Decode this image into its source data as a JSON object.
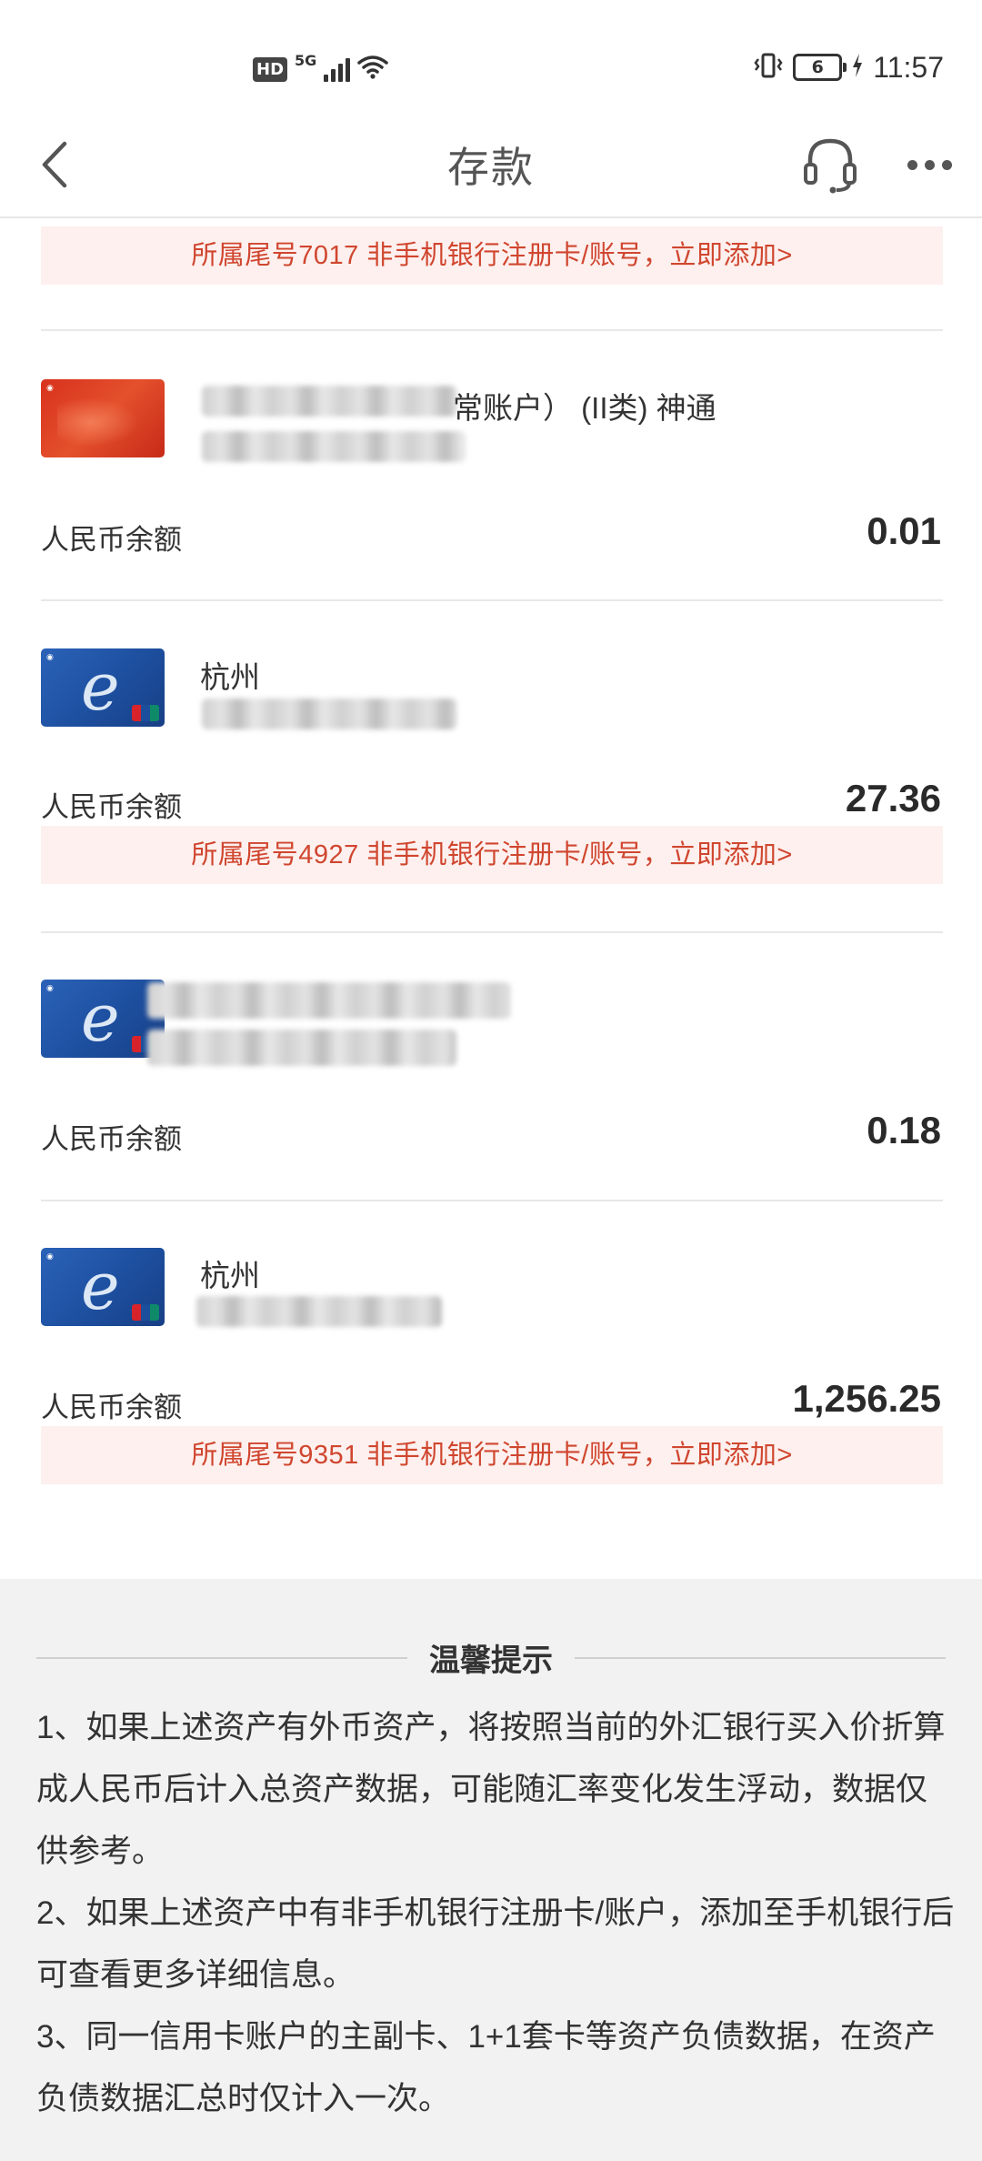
{
  "status_bar": {
    "network_badge": "HD",
    "network_type": "5G",
    "battery_level": "6",
    "time": "11:57"
  },
  "header": {
    "title": "存款",
    "back_icon": "chevron-left-icon",
    "service_icon": "headset-icon",
    "more_icon": "more-dots-icon"
  },
  "top_notice": "所属尾号7017 非手机银行注册卡/账号，立即添加>",
  "accounts": [
    {
      "card_style": "red",
      "name": "常账户） (II类) 神通",
      "balance_label": "人民币余额",
      "balance": "0.01"
    },
    {
      "card_style": "blue",
      "name": "杭州",
      "balance_label": "人民币余额",
      "balance": "27.36",
      "notice": "所属尾号4927 非手机银行注册卡/账号，立即添加>"
    },
    {
      "card_style": "blue",
      "name": "",
      "balance_label": "人民币余额",
      "balance": "0.18"
    },
    {
      "card_style": "blue",
      "name": "杭州",
      "balance_label": "人民币余额",
      "balance": "1,256.25",
      "notice": "所属尾号9351 非手机银行注册卡/账号，立即添加>"
    }
  ],
  "tips": {
    "title": "温馨提示",
    "items": [
      "1、如果上述资产有外币资产，将按照当前的外汇银行买入价折算成人民币后计入总资产数据，可能随汇率变化发生浮动，数据仅供参考。",
      "2、如果上述资产中有非手机银行注册卡/账户，添加至手机银行后可查看更多详细信息。",
      "3、同一信用卡账户的主副卡、1+1套卡等资产负债数据，在资产负债数据汇总时仅计入一次。"
    ]
  },
  "colors": {
    "notice_bg": "#fdf0ee",
    "notice_text": "#d0462f",
    "tips_bg": "#f2f2f2"
  }
}
